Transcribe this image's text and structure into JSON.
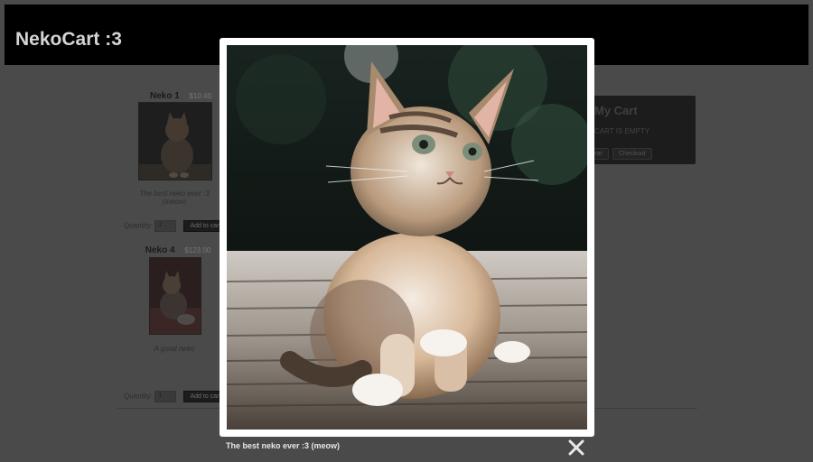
{
  "header": {
    "brand": "NekoCart :3"
  },
  "products": [
    {
      "name": "Neko 1",
      "price": "$10.40",
      "description_line1": "The best neko ever :3",
      "description_line2": "(meow)",
      "quantity_label": "Quantity:",
      "quantity_value": "1",
      "add_button": "Add to cart"
    },
    {
      "name": "Neko 4",
      "price": "$123.00",
      "description_line1": "A good neko",
      "quantity_label": "Quantity:",
      "quantity_value": "1",
      "add_button": "Add to cart"
    }
  ],
  "cart": {
    "title": "My Cart",
    "status": "CART IS EMPTY",
    "clear_button": "Clear",
    "checkout_button": "Checkout"
  },
  "lightbox": {
    "caption": "The best neko ever :3 (meow)",
    "close_icon": "close-icon"
  },
  "colors": {
    "overlay": "#4a4a4a",
    "header_bg": "#000000",
    "brand_text": "#d4d4d4",
    "lightbox_bg": "#ffffff"
  }
}
